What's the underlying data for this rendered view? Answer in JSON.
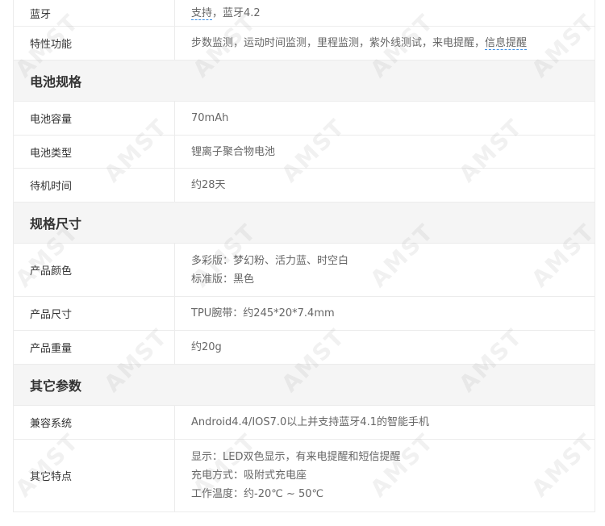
{
  "spec": {
    "rows_top": [
      {
        "label": "蓝牙",
        "value_link": "支持",
        "value_rest": "，蓝牙4.2"
      },
      {
        "label": "特性功能",
        "value_main": "步数监测，运动时间监测，里程监测，紫外线测试，来电提醒，",
        "value_link": "信息提醒"
      }
    ],
    "sections": [
      {
        "title": "电池规格",
        "rows": [
          {
            "label": "电池容量",
            "lines": [
              "70mAh"
            ]
          },
          {
            "label": "电池类型",
            "lines": [
              "锂离子聚合物电池"
            ]
          },
          {
            "label": "待机时间",
            "lines": [
              "约28天"
            ]
          }
        ]
      },
      {
        "title": "规格尺寸",
        "rows": [
          {
            "label": "产品颜色",
            "lines": [
              "多彩版：梦幻粉、活力蓝、时空白",
              "标准版：黑色"
            ]
          },
          {
            "label": "产品尺寸",
            "lines": [
              "TPU腕带：约245*20*7.4mm"
            ]
          },
          {
            "label": "产品重量",
            "lines": [
              "约20g"
            ]
          }
        ]
      },
      {
        "title": "其它参数",
        "rows": [
          {
            "label": "兼容系统",
            "lines": [
              "Android4.4/IOS7.0以上并支持蓝牙4.1的智能手机"
            ]
          },
          {
            "label": "其它特点",
            "lines": [
              "显示：LED双色显示，有来电提醒和短信提醒",
              "充电方式：吸附式充电座",
              "工作温度：约-20℃ ~ 50℃"
            ]
          }
        ]
      }
    ]
  },
  "watermark_text": "AMST"
}
